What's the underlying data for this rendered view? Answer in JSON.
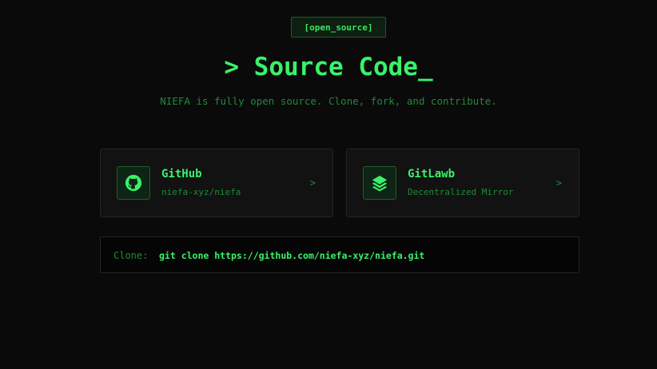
{
  "badge": "[open_source]",
  "title": "> Source Code_",
  "subtitle": "NIEFA is fully open source. Clone, fork, and contribute.",
  "cards": [
    {
      "title": "GitHub",
      "subtitle": "niefa-xyz/niefa",
      "icon": "github-icon",
      "chevron": ">"
    },
    {
      "title": "GitLawb",
      "subtitle": "Decentralized Mirror",
      "icon": "layers-icon",
      "chevron": ">"
    }
  ],
  "clone": {
    "label": "Clone:",
    "command": "git clone https://github.com/niefa-xyz/niefa.git"
  },
  "colors": {
    "background": "#0a0a0a",
    "accent": "#39f26a",
    "muted": "#1f8a3a",
    "card": "#121212",
    "border": "#252525"
  }
}
